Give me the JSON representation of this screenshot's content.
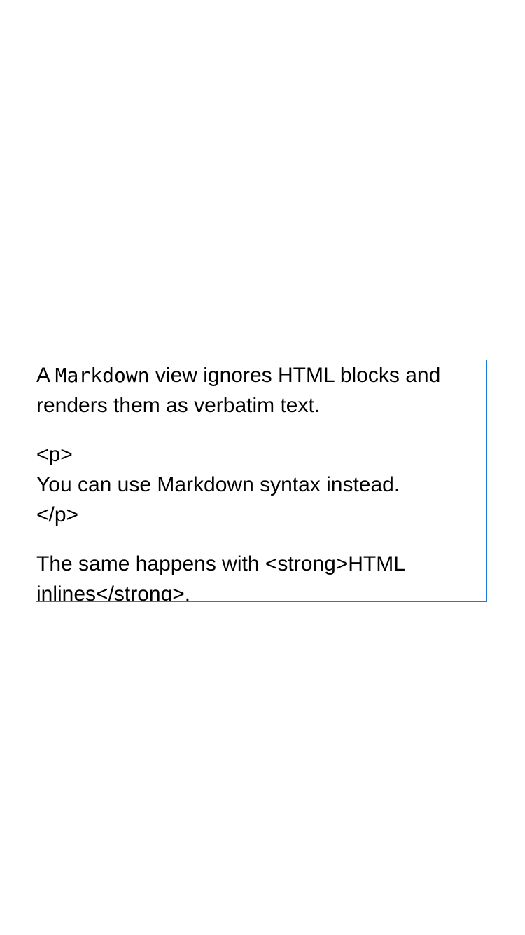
{
  "markdown": {
    "para1": {
      "prefix": "A ",
      "code": "Markdown",
      "suffix": " view ignores HTML blocks and renders them as verbatim text."
    },
    "html_block": {
      "open_tag": "<p>",
      "body": "You can use Markdown syntax instead.",
      "close_tag": "</p>"
    },
    "para3": "The same happens with <strong>HTML inlines</strong>."
  },
  "colors": {
    "border": "#1e7bd8",
    "text": "#000000",
    "background": "#ffffff"
  }
}
